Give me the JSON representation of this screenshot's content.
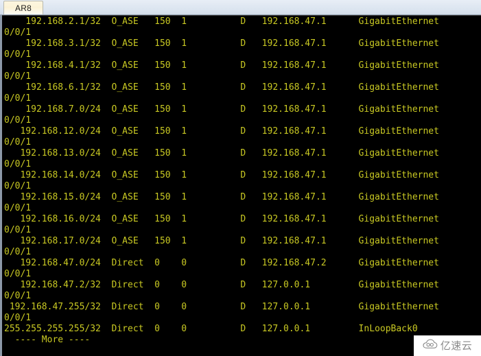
{
  "window": {
    "tabs": [
      {
        "label": "AR8",
        "active": true
      }
    ]
  },
  "console": {
    "colors": {
      "background": "#000000",
      "text": "#c9c923",
      "tab_active": "#fbf2d6",
      "tabstrip": "#dce5f0"
    },
    "pager_prompt": "  ---- More ----",
    "routes": [
      {
        "destination": "192.168.2.1/32",
        "proto": "O_ASE",
        "pre": "150",
        "cost": "1",
        "flags": "D",
        "nexthop": "192.168.47.1",
        "interface": "GigabitEthernet",
        "interface_cont": "0/0/1"
      },
      {
        "destination": "192.168.3.1/32",
        "proto": "O_ASE",
        "pre": "150",
        "cost": "1",
        "flags": "D",
        "nexthop": "192.168.47.1",
        "interface": "GigabitEthernet",
        "interface_cont": "0/0/1"
      },
      {
        "destination": "192.168.4.1/32",
        "proto": "O_ASE",
        "pre": "150",
        "cost": "1",
        "flags": "D",
        "nexthop": "192.168.47.1",
        "interface": "GigabitEthernet",
        "interface_cont": "0/0/1"
      },
      {
        "destination": "192.168.6.1/32",
        "proto": "O_ASE",
        "pre": "150",
        "cost": "1",
        "flags": "D",
        "nexthop": "192.168.47.1",
        "interface": "GigabitEthernet",
        "interface_cont": "0/0/1"
      },
      {
        "destination": "192.168.7.0/24",
        "proto": "O_ASE",
        "pre": "150",
        "cost": "1",
        "flags": "D",
        "nexthop": "192.168.47.1",
        "interface": "GigabitEthernet",
        "interface_cont": "0/0/1"
      },
      {
        "destination": "192.168.12.0/24",
        "proto": "O_ASE",
        "pre": "150",
        "cost": "1",
        "flags": "D",
        "nexthop": "192.168.47.1",
        "interface": "GigabitEthernet",
        "interface_cont": "0/0/1"
      },
      {
        "destination": "192.168.13.0/24",
        "proto": "O_ASE",
        "pre": "150",
        "cost": "1",
        "flags": "D",
        "nexthop": "192.168.47.1",
        "interface": "GigabitEthernet",
        "interface_cont": "0/0/1"
      },
      {
        "destination": "192.168.14.0/24",
        "proto": "O_ASE",
        "pre": "150",
        "cost": "1",
        "flags": "D",
        "nexthop": "192.168.47.1",
        "interface": "GigabitEthernet",
        "interface_cont": "0/0/1"
      },
      {
        "destination": "192.168.15.0/24",
        "proto": "O_ASE",
        "pre": "150",
        "cost": "1",
        "flags": "D",
        "nexthop": "192.168.47.1",
        "interface": "GigabitEthernet",
        "interface_cont": "0/0/1"
      },
      {
        "destination": "192.168.16.0/24",
        "proto": "O_ASE",
        "pre": "150",
        "cost": "1",
        "flags": "D",
        "nexthop": "192.168.47.1",
        "interface": "GigabitEthernet",
        "interface_cont": "0/0/1"
      },
      {
        "destination": "192.168.17.0/24",
        "proto": "O_ASE",
        "pre": "150",
        "cost": "1",
        "flags": "D",
        "nexthop": "192.168.47.1",
        "interface": "GigabitEthernet",
        "interface_cont": "0/0/1"
      },
      {
        "destination": "192.168.47.0/24",
        "proto": "Direct",
        "pre": "0",
        "cost": "0",
        "flags": "D",
        "nexthop": "192.168.47.2",
        "interface": "GigabitEthernet",
        "interface_cont": "0/0/1"
      },
      {
        "destination": "192.168.47.2/32",
        "proto": "Direct",
        "pre": "0",
        "cost": "0",
        "flags": "D",
        "nexthop": "127.0.0.1",
        "interface": "GigabitEthernet",
        "interface_cont": "0/0/1"
      },
      {
        "destination": "192.168.47.255/32",
        "proto": "Direct",
        "pre": "0",
        "cost": "0",
        "flags": "D",
        "nexthop": "127.0.0.1",
        "interface": "GigabitEthernet",
        "interface_cont": "0/0/1"
      },
      {
        "destination": "255.255.255.255/32",
        "proto": "Direct",
        "pre": "0",
        "cost": "0",
        "flags": "D",
        "nexthop": "127.0.0.1",
        "interface": "InLoopBack0",
        "interface_cont": ""
      }
    ]
  },
  "watermark": {
    "text": "亿速云",
    "icon": "cloud-icon"
  }
}
